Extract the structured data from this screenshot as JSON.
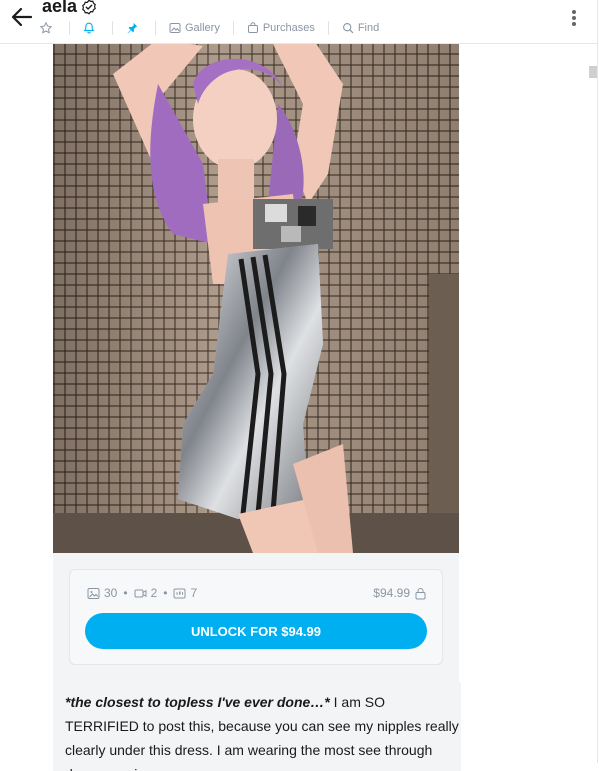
{
  "header": {
    "title": "aela",
    "tabs": [
      {
        "label": "",
        "icon": "star-icon"
      },
      {
        "label": "",
        "icon": "bell-icon"
      },
      {
        "label": "",
        "icon": "pin-icon"
      },
      {
        "label": "Gallery",
        "icon": "image-icon"
      },
      {
        "label": "Purchases",
        "icon": "bag-icon"
      },
      {
        "label": "Find",
        "icon": "search-icon"
      }
    ]
  },
  "post": {
    "photo": {
      "image": "photo"
    },
    "media_counts": {
      "photos": "30",
      "videos": "2",
      "gifs": "7"
    },
    "price": "$94.99",
    "unlock_label": "UNLOCK FOR $94.99",
    "caption_emphasis": "*the closest to topless I've ever done…*",
    "caption_text": " I am SO TERRIFIED to post this, because you can see my nipples really clearly under this dress. I am wearing the most see through dress ever in"
  },
  "colors": {
    "accent": "#00aff0",
    "muted": "#8a96a3",
    "card_bg": "#f2f4f6"
  }
}
